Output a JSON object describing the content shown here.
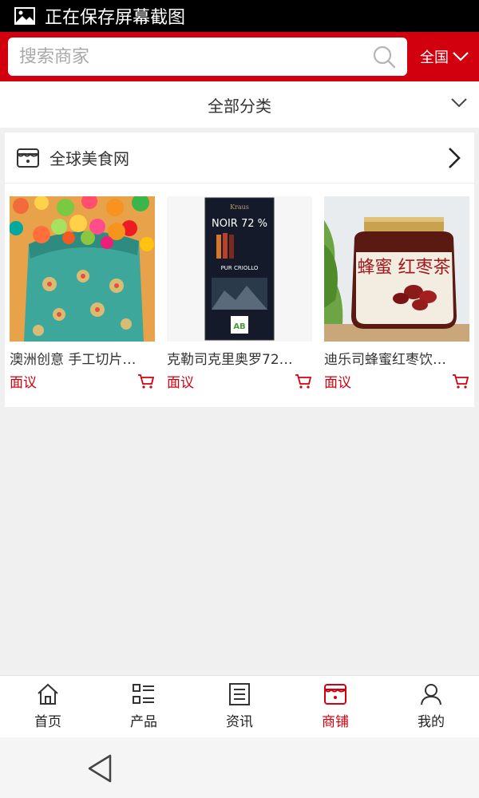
{
  "status_bar": {
    "text": "正在保存屏幕截图",
    "icon": "gallery-icon"
  },
  "header": {
    "search": {
      "placeholder": "搜索商家",
      "value": ""
    },
    "region": "全国",
    "accent_color": "#d2000e"
  },
  "category": {
    "label": "全部分类"
  },
  "shop": {
    "name": "全球美食网",
    "products": [
      {
        "name": "澳洲创意 手工切片…",
        "price": "面议"
      },
      {
        "name": "克勒司克里奥罗72…",
        "price": "面议"
      },
      {
        "name": "迪乐司蜂蜜红枣饮…",
        "price": "面议"
      }
    ],
    "product_images": {
      "chocolate": {
        "brand": "NOIR 72 %",
        "line": "PUR CRIOLLO"
      },
      "jar": {
        "label": "蜂蜜 红枣茶"
      }
    }
  },
  "bottom_nav": [
    {
      "label": "首页",
      "icon": "home-icon",
      "active": false
    },
    {
      "label": "产品",
      "icon": "list-icon",
      "active": false
    },
    {
      "label": "资讯",
      "icon": "news-icon",
      "active": false
    },
    {
      "label": "商铺",
      "icon": "store-icon",
      "active": true
    },
    {
      "label": "我的",
      "icon": "user-icon",
      "active": false
    }
  ]
}
